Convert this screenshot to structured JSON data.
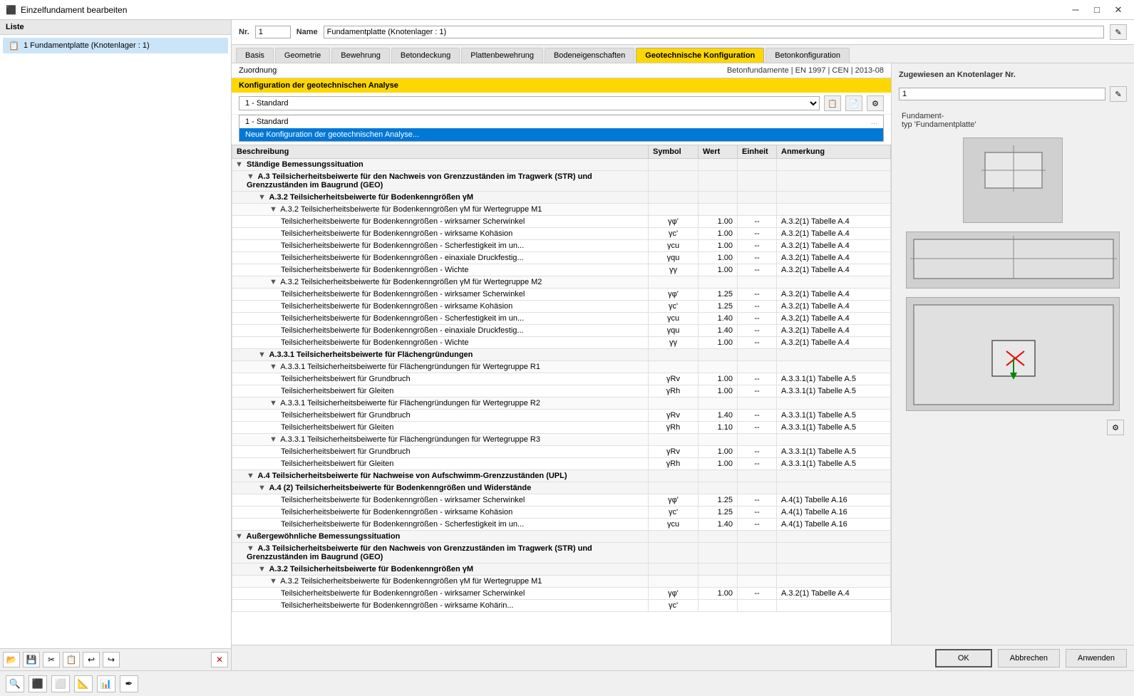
{
  "titleBar": {
    "title": "Einzelfundament bearbeiten",
    "iconSymbol": "⬛"
  },
  "leftPanel": {
    "header": "Liste",
    "items": [
      {
        "id": 1,
        "label": "1  Fundamentplatte (Knotenlager : 1)"
      }
    ],
    "toolbar": {
      "buttons": [
        "📂",
        "💾",
        "✂",
        "📋",
        "↩",
        "↪"
      ],
      "deleteLabel": "✕"
    }
  },
  "topSection": {
    "nrLabel": "Nr.",
    "nrValue": "1",
    "nameLabel": "Name",
    "nameValue": "Fundamentplatte (Knotenlager : 1)",
    "editIcon": "✎"
  },
  "tabs": [
    {
      "id": "basis",
      "label": "Basis",
      "active": false
    },
    {
      "id": "geometrie",
      "label": "Geometrie",
      "active": false
    },
    {
      "id": "bewehrung",
      "label": "Bewehrung",
      "active": false
    },
    {
      "id": "betondeckung",
      "label": "Betondeckung",
      "active": false
    },
    {
      "id": "plattenbewehrung",
      "label": "Plattenbewehrung",
      "active": false
    },
    {
      "id": "bodeneigenschaften",
      "label": "Bodeneigenschaften",
      "active": false
    },
    {
      "id": "geotechnische",
      "label": "Geotechnische Konfiguration",
      "active": true
    },
    {
      "id": "betonkonfiguration",
      "label": "Betonkonfiguration",
      "active": false
    }
  ],
  "zuordnungRow": {
    "leftLabel": "Zuordnung",
    "rightLabel": "Betonfundamente | EN 1997 | CEN | 2013-08"
  },
  "konfigNotice": "Konfiguration der geotechnischen Analyse",
  "dropdown": {
    "selectedValue": "1 - Standard",
    "addIcon": "📋",
    "copyIcon": "📄",
    "moreIcon": "⚙",
    "listItems": [
      {
        "label": "1 - Standard",
        "dots": "..."
      },
      {
        "label": "Neue Konfiguration der geotechnischen Analyse...",
        "selected": true
      }
    ]
  },
  "tableHeader": {
    "beschreibung": "Beschreibung",
    "symbol": "Symbol",
    "wert": "Wert",
    "einheit": "Einheit",
    "anmerkung": "Anmerkung"
  },
  "tableData": [
    {
      "indent": 0,
      "triangle": "▼",
      "text": "Ständige Bemessungssituation",
      "symbol": "",
      "wert": "",
      "einheit": "",
      "anmerkung": "",
      "type": "section"
    },
    {
      "indent": 1,
      "triangle": "▼",
      "text": "A.3 Teilsicherheitsbeiwerte für den Nachweis von Grenzzuständen im Tragwerk (STR) und Grenzzuständen im Baugrund (GEO)",
      "symbol": "",
      "wert": "",
      "einheit": "",
      "anmerkung": "",
      "type": "section"
    },
    {
      "indent": 2,
      "triangle": "▼",
      "text": "A.3.2 Teilsicherheitsbeiwerte für Bodenkenngrößen γM",
      "symbol": "",
      "wert": "",
      "einheit": "",
      "anmerkung": "",
      "type": "section"
    },
    {
      "indent": 3,
      "triangle": "▼",
      "text": "A.3.2 Teilsicherheitsbeiwerte für Bodenkenngrößen γM für Wertegruppe M1",
      "symbol": "",
      "wert": "",
      "einheit": "",
      "anmerkung": "",
      "type": "subsection"
    },
    {
      "indent": 4,
      "triangle": "",
      "text": "Teilsicherheitsbeiwerte für Bodenkenngrößen - wirksamer Scherwinkel",
      "symbol": "γφ'",
      "wert": "1.00",
      "einheit": "--",
      "anmerkung": "A.3.2(1) Tabelle A.4",
      "type": "leaf"
    },
    {
      "indent": 4,
      "triangle": "",
      "text": "Teilsicherheitsbeiwerte für Bodenkenngrößen - wirksame Kohäsion",
      "symbol": "γc'",
      "wert": "1.00",
      "einheit": "--",
      "anmerkung": "A.3.2(1) Tabelle A.4",
      "type": "leaf"
    },
    {
      "indent": 4,
      "triangle": "",
      "text": "Teilsicherheitsbeiwerte für Bodenkenngrößen - Scherfestigkeit im un...",
      "symbol": "γcu",
      "wert": "1.00",
      "einheit": "--",
      "anmerkung": "A.3.2(1) Tabelle A.4",
      "type": "leaf"
    },
    {
      "indent": 4,
      "triangle": "",
      "text": "Teilsicherheitsbeiwerte für Bodenkenngrößen - einaxiale Druckfestig...",
      "symbol": "γqu",
      "wert": "1.00",
      "einheit": "--",
      "anmerkung": "A.3.2(1) Tabelle A.4",
      "type": "leaf"
    },
    {
      "indent": 4,
      "triangle": "",
      "text": "Teilsicherheitsbeiwerte für Bodenkenngrößen - Wichte",
      "symbol": "γγ",
      "wert": "1.00",
      "einheit": "--",
      "anmerkung": "A.3.2(1) Tabelle A.4",
      "type": "leaf"
    },
    {
      "indent": 3,
      "triangle": "▼",
      "text": "A.3.2 Teilsicherheitsbeiwerte für Bodenkenngrößen γM für Wertegruppe M2",
      "symbol": "",
      "wert": "",
      "einheit": "",
      "anmerkung": "",
      "type": "subsection"
    },
    {
      "indent": 4,
      "triangle": "",
      "text": "Teilsicherheitsbeiwerte für Bodenkenngrößen - wirksamer Scherwinkel",
      "symbol": "γφ'",
      "wert": "1.25",
      "einheit": "--",
      "anmerkung": "A.3.2(1) Tabelle A.4",
      "type": "leaf"
    },
    {
      "indent": 4,
      "triangle": "",
      "text": "Teilsicherheitsbeiwerte für Bodenkenngrößen - wirksame Kohäsion",
      "symbol": "γc'",
      "wert": "1.25",
      "einheit": "--",
      "anmerkung": "A.3.2(1) Tabelle A.4",
      "type": "leaf"
    },
    {
      "indent": 4,
      "triangle": "",
      "text": "Teilsicherheitsbeiwerte für Bodenkenngrößen - Scherfestigkeit im un...",
      "symbol": "γcu",
      "wert": "1.40",
      "einheit": "--",
      "anmerkung": "A.3.2(1) Tabelle A.4",
      "type": "leaf"
    },
    {
      "indent": 4,
      "triangle": "",
      "text": "Teilsicherheitsbeiwerte für Bodenkenngrößen - einaxiale Druckfestig...",
      "symbol": "γqu",
      "wert": "1.40",
      "einheit": "--",
      "anmerkung": "A.3.2(1) Tabelle A.4",
      "type": "leaf"
    },
    {
      "indent": 4,
      "triangle": "",
      "text": "Teilsicherheitsbeiwerte für Bodenkenngrößen - Wichte",
      "symbol": "γγ",
      "wert": "1.00",
      "einheit": "--",
      "anmerkung": "A.3.2(1) Tabelle A.4",
      "type": "leaf"
    },
    {
      "indent": 2,
      "triangle": "▼",
      "text": "A.3.3.1 Teilsicherheitsbeiwerte für Flächengründungen",
      "symbol": "",
      "wert": "",
      "einheit": "",
      "anmerkung": "",
      "type": "section"
    },
    {
      "indent": 3,
      "triangle": "▼",
      "text": "A.3.3.1 Teilsicherheitsbeiwerte für Flächengründungen für Wertegruppe R1",
      "symbol": "",
      "wert": "",
      "einheit": "",
      "anmerkung": "",
      "type": "subsection"
    },
    {
      "indent": 4,
      "triangle": "",
      "text": "Teilsicherheitsbeiwert für Grundbruch",
      "symbol": "γRv",
      "wert": "1.00",
      "einheit": "--",
      "anmerkung": "A.3.3.1(1) Tabelle A.5",
      "type": "leaf"
    },
    {
      "indent": 4,
      "triangle": "",
      "text": "Teilsicherheitsbeiwert für Gleiten",
      "symbol": "γRh",
      "wert": "1.00",
      "einheit": "--",
      "anmerkung": "A.3.3.1(1) Tabelle A.5",
      "type": "leaf"
    },
    {
      "indent": 3,
      "triangle": "▼",
      "text": "A.3.3.1 Teilsicherheitsbeiwerte für Flächengründungen für Wertegruppe R2",
      "symbol": "",
      "wert": "",
      "einheit": "",
      "anmerkung": "",
      "type": "subsection"
    },
    {
      "indent": 4,
      "triangle": "",
      "text": "Teilsicherheitsbeiwert für Grundbruch",
      "symbol": "γRv",
      "wert": "1.40",
      "einheit": "--",
      "anmerkung": "A.3.3.1(1) Tabelle A.5",
      "type": "leaf"
    },
    {
      "indent": 4,
      "triangle": "",
      "text": "Teilsicherheitsbeiwert für Gleiten",
      "symbol": "γRh",
      "wert": "1.10",
      "einheit": "--",
      "anmerkung": "A.3.3.1(1) Tabelle A.5",
      "type": "leaf"
    },
    {
      "indent": 3,
      "triangle": "▼",
      "text": "A.3.3.1 Teilsicherheitsbeiwerte für Flächengründungen für Wertegruppe R3",
      "symbol": "",
      "wert": "",
      "einheit": "",
      "anmerkung": "",
      "type": "subsection"
    },
    {
      "indent": 4,
      "triangle": "",
      "text": "Teilsicherheitsbeiwert für Grundbruch",
      "symbol": "γRv",
      "wert": "1.00",
      "einheit": "--",
      "anmerkung": "A.3.3.1(1) Tabelle A.5",
      "type": "leaf"
    },
    {
      "indent": 4,
      "triangle": "",
      "text": "Teilsicherheitsbeiwert für Gleiten",
      "symbol": "γRh",
      "wert": "1.00",
      "einheit": "--",
      "anmerkung": "A.3.3.1(1) Tabelle A.5",
      "type": "leaf"
    },
    {
      "indent": 1,
      "triangle": "▼",
      "text": "A.4 Teilsicherheitsbeiwerte für Nachweise von Aufschwimm-Grenzzuständen (UPL)",
      "symbol": "",
      "wert": "",
      "einheit": "",
      "anmerkung": "",
      "type": "section"
    },
    {
      "indent": 2,
      "triangle": "▼",
      "text": "A.4 (2) Teilsicherheitsbeiwerte für Bodenkenngrößen und Widerstände",
      "symbol": "",
      "wert": "",
      "einheit": "",
      "anmerkung": "",
      "type": "section"
    },
    {
      "indent": 4,
      "triangle": "",
      "text": "Teilsicherheitsbeiwerte für Bodenkenngrößen - wirksamer Scherwinkel",
      "symbol": "γφ'",
      "wert": "1.25",
      "einheit": "--",
      "anmerkung": "A.4(1) Tabelle A.16",
      "type": "leaf"
    },
    {
      "indent": 4,
      "triangle": "",
      "text": "Teilsicherheitsbeiwerte für Bodenkenngrößen - wirksame Kohäsion",
      "symbol": "γc'",
      "wert": "1.25",
      "einheit": "--",
      "anmerkung": "A.4(1) Tabelle A.16",
      "type": "leaf"
    },
    {
      "indent": 4,
      "triangle": "",
      "text": "Teilsicherheitsbeiwerte für Bodenkenngrößen - Scherfestigkeit im un...",
      "symbol": "γcu",
      "wert": "1.40",
      "einheit": "--",
      "anmerkung": "A.4(1) Tabelle A.16",
      "type": "leaf"
    },
    {
      "indent": 0,
      "triangle": "▼",
      "text": "Außergewöhnliche Bemessungssituation",
      "symbol": "",
      "wert": "",
      "einheit": "",
      "anmerkung": "",
      "type": "section"
    },
    {
      "indent": 1,
      "triangle": "▼",
      "text": "A.3 Teilsicherheitsbeiwerte für den Nachweis von Grenzzuständen im Tragwerk (STR) und Grenzzuständen im Baugrund (GEO)",
      "symbol": "",
      "wert": "",
      "einheit": "",
      "anmerkung": "",
      "type": "section"
    },
    {
      "indent": 2,
      "triangle": "▼",
      "text": "A.3.2 Teilsicherheitsbeiwerte für Bodenkenngrößen γM",
      "symbol": "",
      "wert": "",
      "einheit": "",
      "anmerkung": "",
      "type": "section"
    },
    {
      "indent": 3,
      "triangle": "▼",
      "text": "A.3.2 Teilsicherheitsbeiwerte für Bodenkenngrößen γM für Wertegruppe M1",
      "symbol": "",
      "wert": "",
      "einheit": "",
      "anmerkung": "",
      "type": "subsection"
    },
    {
      "indent": 4,
      "triangle": "",
      "text": "Teilsicherheitsbeiwerte für Bodenkenngrößen - wirksamer Scherwinkel",
      "symbol": "γφ'",
      "wert": "1.00",
      "einheit": "--",
      "anmerkung": "A.3.2(1) Tabelle A.4",
      "type": "leaf"
    },
    {
      "indent": 4,
      "triangle": "",
      "text": "Teilsicherheitsbeiwerte für Bodenkenngrößen - wirksame Kohärin...",
      "symbol": "γc'",
      "wert": "",
      "einheit": "",
      "anmerkung": "",
      "type": "leaf"
    }
  ],
  "rightPanel": {
    "header": "Zugewiesen an Knotenlager Nr.",
    "value": "1",
    "editIcon": "✎",
    "fundamentTypLabel": "Fundament-",
    "fundamentTypLabel2": "typ 'Fundamentplatte'",
    "bottomIcon": "⚙"
  },
  "bottomButtons": {
    "ok": "OK",
    "abbrechen": "Abbrechen",
    "anwenden": "Anwenden"
  },
  "bottomToolbar": {
    "icons": [
      "🔍",
      "⬛",
      "⬜",
      "📐",
      "📊",
      "✒"
    ]
  }
}
